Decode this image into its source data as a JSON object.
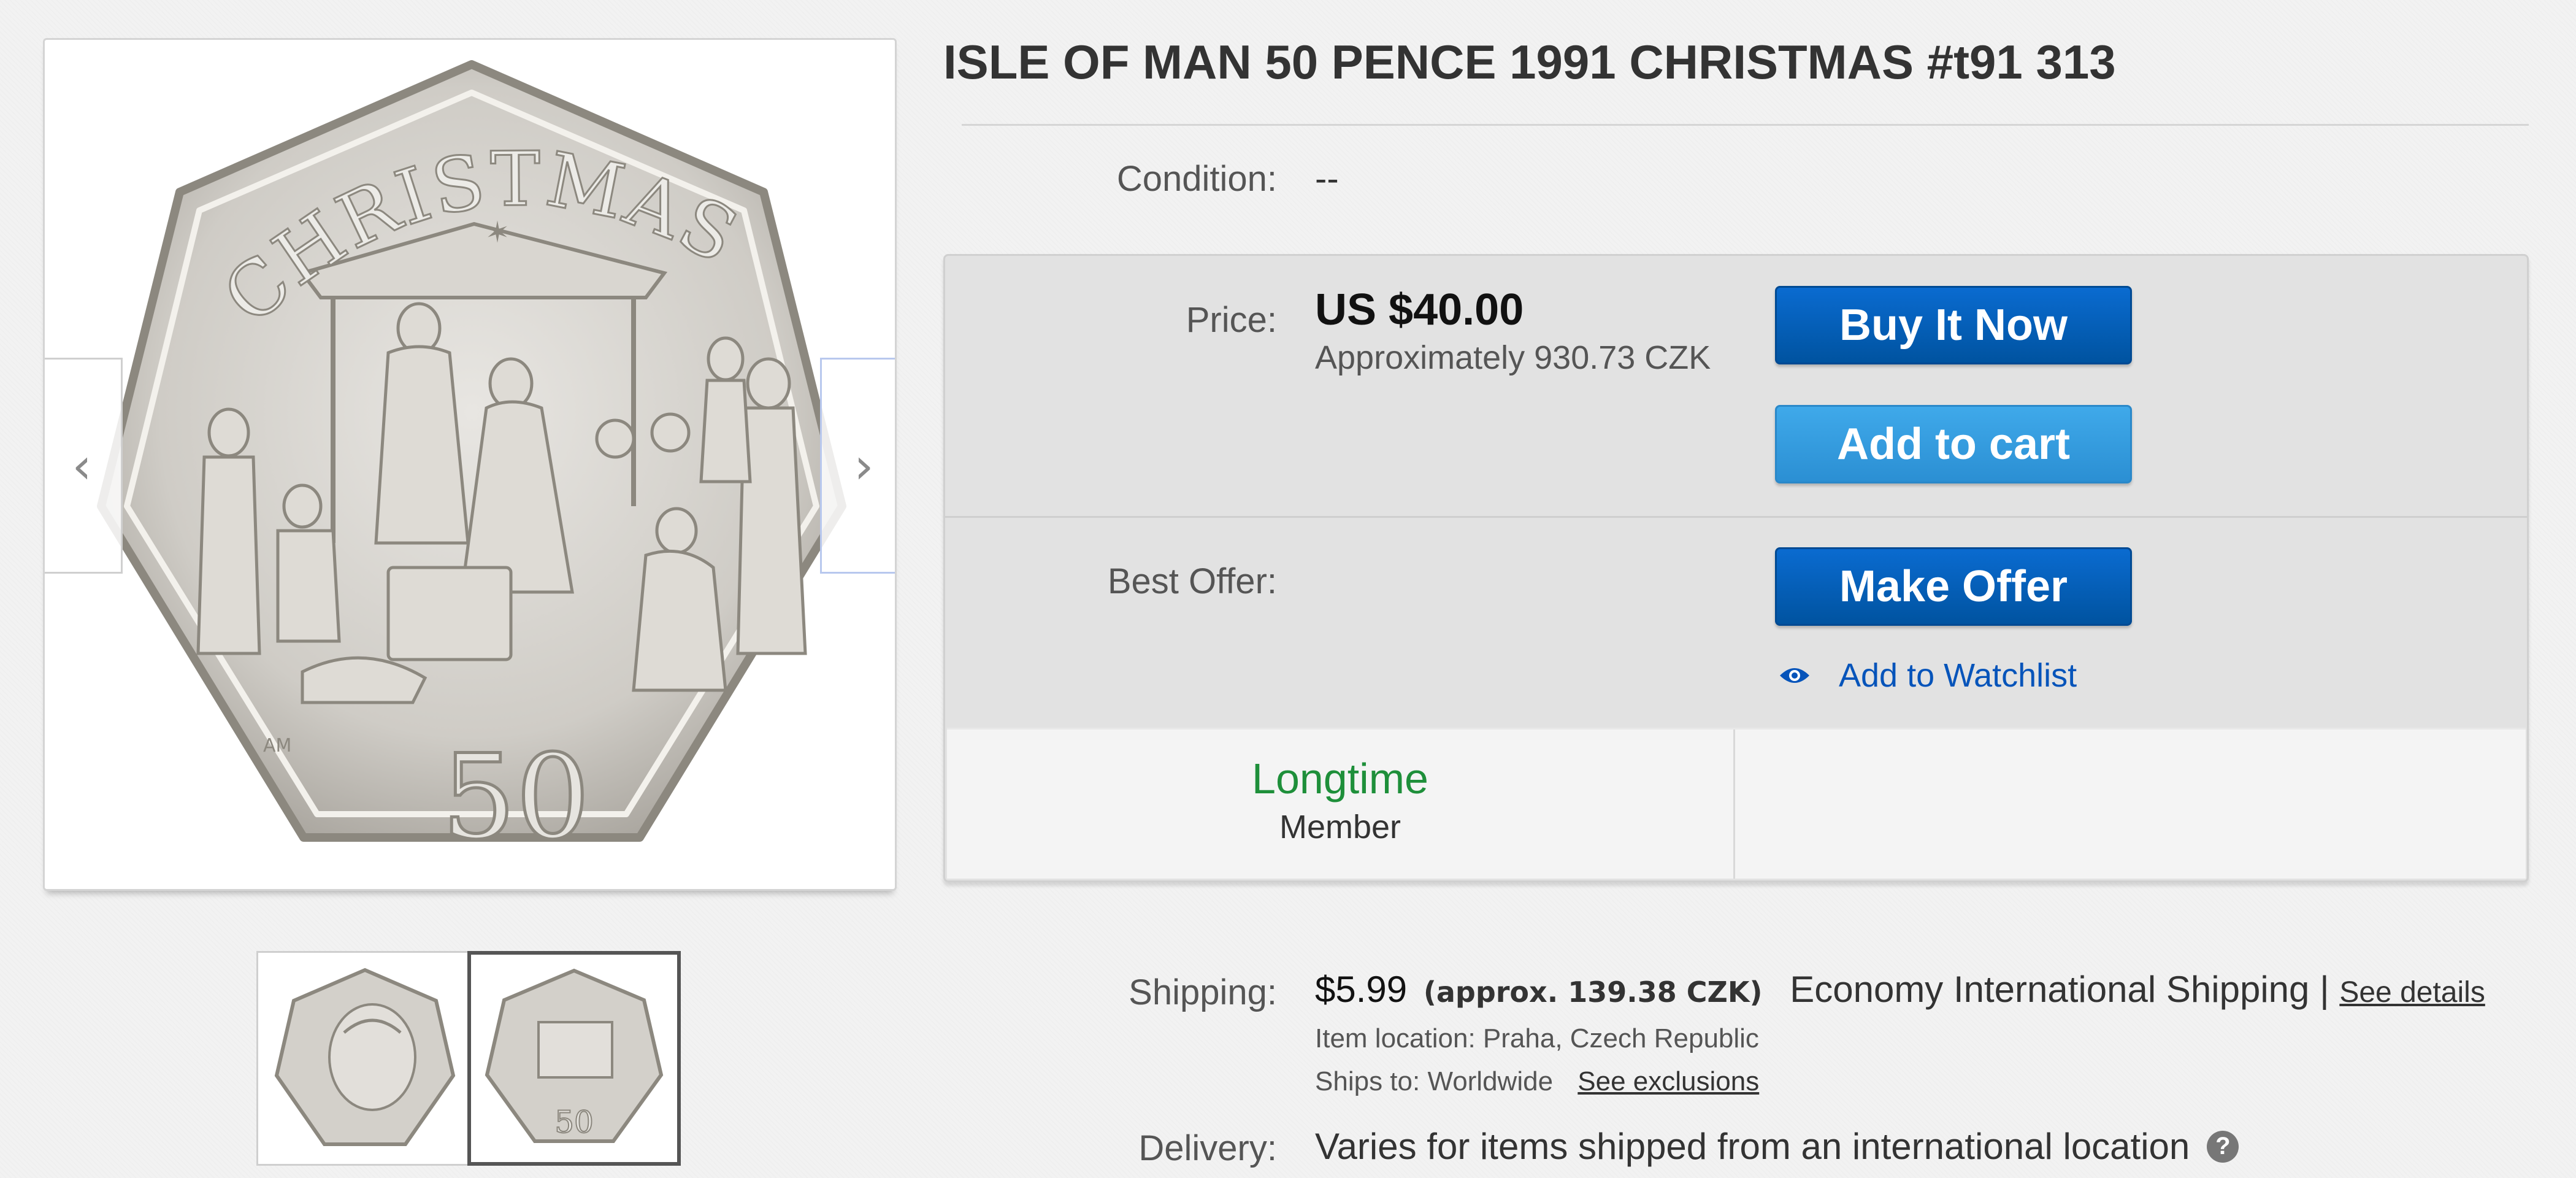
{
  "listing": {
    "title": "ISLE OF MAN 50 PENCE 1991 CHRISTMAS #t91 313",
    "condition_label": "Condition:",
    "condition_value": "--"
  },
  "gallery": {
    "prev_icon": "chevron-left-icon",
    "next_icon": "chevron-right-icon",
    "prev_glyph": "‹",
    "next_glyph": "›",
    "coin_inscription": "CHRISTMAS",
    "coin_value": "50",
    "coin_initials": "AM"
  },
  "purchase": {
    "price_label": "Price:",
    "price_value": "US $40.00",
    "price_approx": "Approximately 930.73 CZK",
    "buy_now_label": "Buy It Now",
    "add_to_cart_label": "Add to cart",
    "best_offer_label": "Best Offer:",
    "make_offer_label": "Make Offer",
    "watchlist_label": "Add to Watchlist",
    "watchlist_icon": "eye-icon"
  },
  "member": {
    "title": "Longtime",
    "subtitle": "Member"
  },
  "shipping": {
    "label": "Shipping:",
    "cost": "$5.99",
    "approx": "(approx. 139.38 CZK)",
    "method": "Economy International Shipping |",
    "details_link": "See details",
    "location_prefix": "Item location:",
    "location_value": "Praha, Czech Republic",
    "ships_to_prefix": "Ships to:",
    "ships_to_value": "Worldwide",
    "exclusions_link": "See exclusions"
  },
  "delivery": {
    "label": "Delivery:",
    "value": "Varies for items shipped from an international location",
    "help_icon": "question-icon",
    "help_glyph": "?"
  },
  "colors": {
    "primary_button": "#0053a0",
    "secondary_button": "#3fa9ea",
    "link": "#0654ba",
    "member_green": "#1e8f3a"
  }
}
